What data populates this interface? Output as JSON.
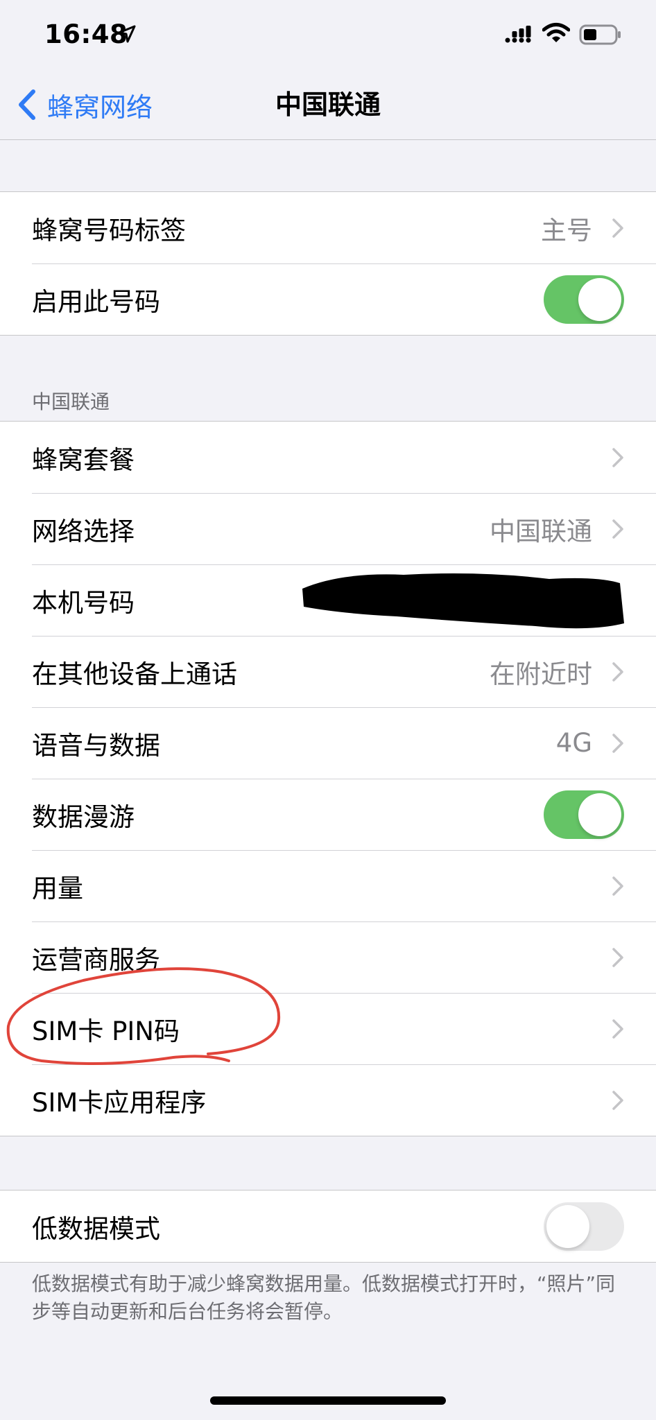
{
  "status_bar": {
    "time": "16:48",
    "icons": [
      "location-arrow-icon",
      "signal-icon",
      "wifi-icon",
      "battery-icon"
    ]
  },
  "nav": {
    "back_label": "蜂窝网络",
    "title": "中国联通",
    "accent_color": "#2f7bf5"
  },
  "group1": {
    "rows": [
      {
        "label": "蜂窝号码标签",
        "value": "主号"
      },
      {
        "label": "启用此号码",
        "toggle": "on"
      }
    ]
  },
  "section2": {
    "header": "中国联通",
    "rows": [
      {
        "label": "蜂窝套餐"
      },
      {
        "label": "网络选择",
        "value": "中国联通"
      },
      {
        "label": "本机号码",
        "value_redacted": true
      },
      {
        "label": "在其他设备上通话",
        "value": "在附近时"
      },
      {
        "label": "语音与数据",
        "value": "4G"
      },
      {
        "label": "数据漫游",
        "toggle": "on"
      },
      {
        "label": "用量"
      },
      {
        "label": "运营商服务"
      },
      {
        "label": "SIM卡 PIN码",
        "annotated": true
      },
      {
        "label": "SIM卡应用程序"
      }
    ]
  },
  "group3": {
    "rows": [
      {
        "label": "低数据模式",
        "toggle": "off"
      }
    ],
    "footer": "低数据模式有助于减少蜂窝数据用量。低数据模式打开时，“照片”同步等自动更新和后台任务将会暂停。"
  },
  "colors": {
    "toggle_on": "#65c466",
    "toggle_off": "#e9e9ea",
    "annotation": "#e0443a"
  }
}
